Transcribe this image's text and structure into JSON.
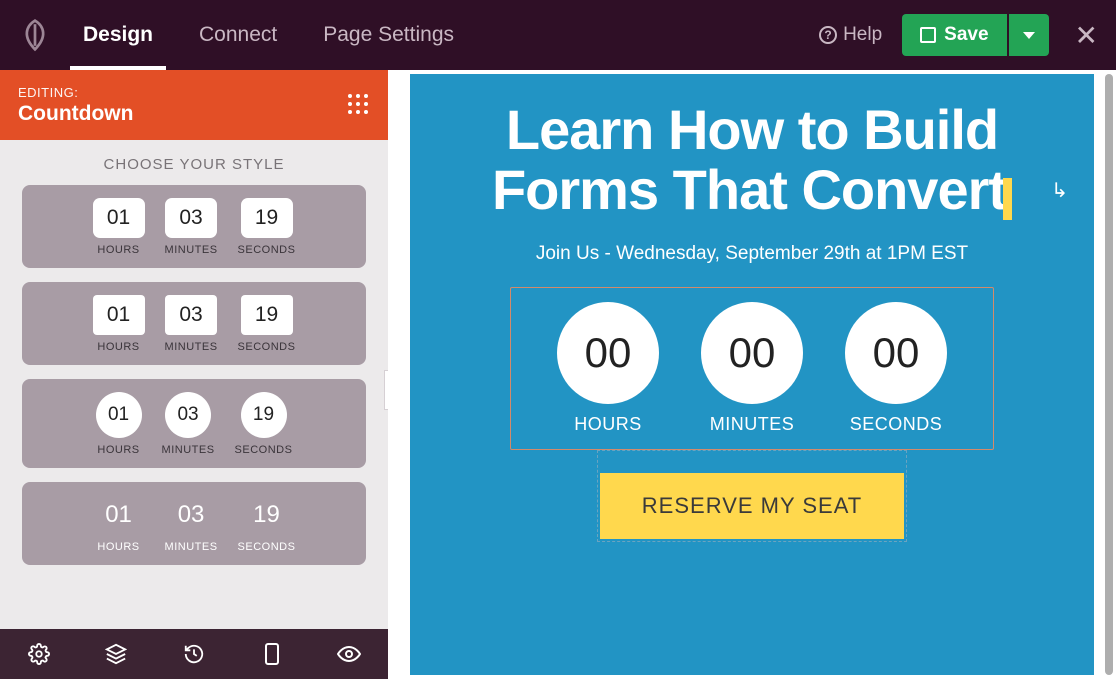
{
  "topbar": {
    "tabs": {
      "design": "Design",
      "connect": "Connect",
      "settings": "Page Settings"
    },
    "help": "Help",
    "save": "Save"
  },
  "panel": {
    "editing_label": "EDITING:",
    "block_name": "Countdown",
    "style_heading": "CHOOSE YOUR STYLE"
  },
  "styles": {
    "h": "01",
    "m": "03",
    "s": "19",
    "hl": "HOURS",
    "ml": "MINUTES",
    "sl": "SECONDS"
  },
  "preview": {
    "title_l1": "Learn How to Build",
    "title_l2": "Forms That Convert",
    "subtitle": "Join Us - Wednesday, September 29th at 1PM EST",
    "cd": {
      "h": "00",
      "m": "00",
      "s": "00",
      "hl": "HOURS",
      "ml": "MINUTES",
      "sl": "SECONDS"
    },
    "cta": "RESERVE MY SEAT"
  },
  "collapse_glyph": "‹"
}
